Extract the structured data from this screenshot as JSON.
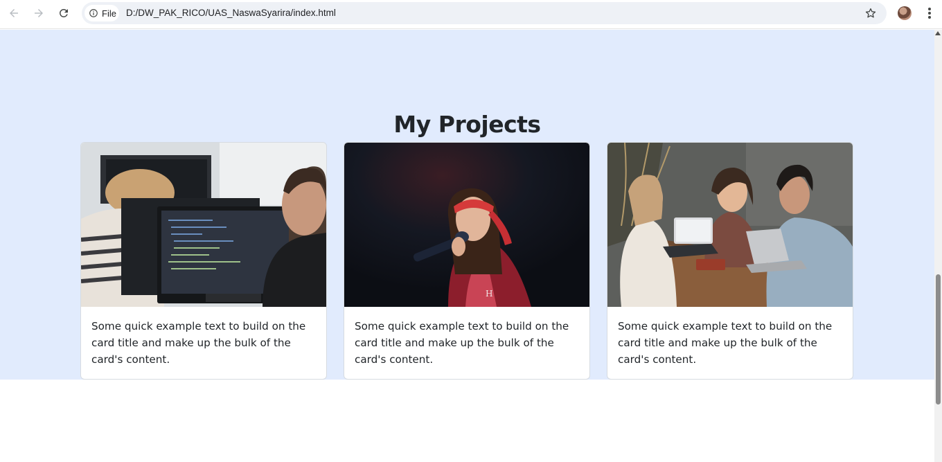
{
  "browser": {
    "site_chip_label": "File",
    "url": "D:/DW_PAK_RICO/UAS_NaswaSyarira/index.html"
  },
  "icons": {
    "back": "arrow-left-icon",
    "forward": "arrow-right-icon",
    "reload": "reload-icon",
    "info": "info-icon",
    "bookmark": "star-icon",
    "profile": "avatar",
    "menu": "kebab-menu-icon"
  },
  "page": {
    "heading": "My Projects",
    "cards": [
      {
        "image": "programmers-at-computers-photo",
        "text": "Some quick example text to build on the card title and make up the bulk of the card's content."
      },
      {
        "image": "singer-with-microphone-photo",
        "text": "Some quick example text to build on the card title and make up the bulk of the card's content."
      },
      {
        "image": "friends-laughing-at-cafe-photo",
        "text": "Some quick example text to build on the card title and make up the bulk of the card's content."
      }
    ]
  },
  "colors": {
    "section_bg": "#e1ebfd",
    "heading": "#212529",
    "card_border": "#d6dbe1"
  }
}
